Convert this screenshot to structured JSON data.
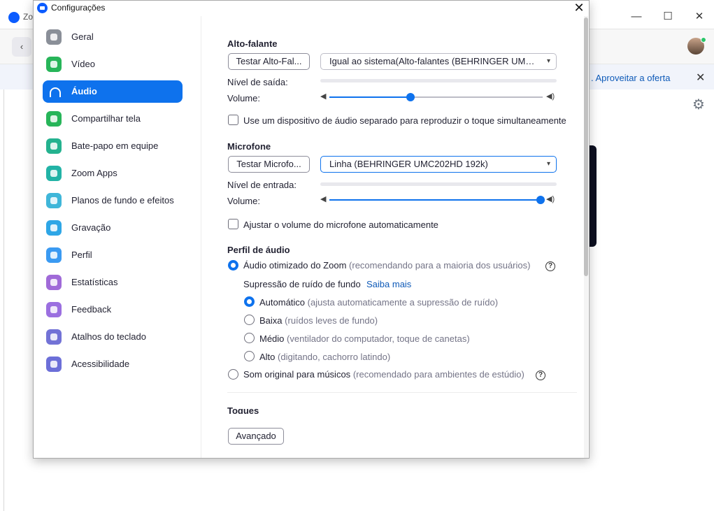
{
  "background": {
    "app_title": "Zoo",
    "offer_text": ". Aproveitar a oferta",
    "window_controls": {
      "minimize": "—",
      "maximize": "☐",
      "close": "✕"
    }
  },
  "dialog": {
    "title": "Configurações",
    "close_glyph": "✕"
  },
  "sidebar": {
    "items": [
      {
        "label": "Geral",
        "icon": "gear-icon",
        "color": "#8a8f98"
      },
      {
        "label": "Vídeo",
        "icon": "video-icon",
        "color": "#27b559"
      },
      {
        "label": "Áudio",
        "icon": "headphones-icon",
        "color": "#0e72ed",
        "active": true
      },
      {
        "label": "Compartilhar tela",
        "icon": "share-screen-icon",
        "color": "#27b559"
      },
      {
        "label": "Bate-papo em equipe",
        "icon": "chat-icon",
        "color": "#24b28f"
      },
      {
        "label": "Zoom Apps",
        "icon": "apps-icon",
        "color": "#22b3a6"
      },
      {
        "label": "Planos de fundo e efeitos",
        "icon": "background-icon",
        "color": "#3fb6d9"
      },
      {
        "label": "Gravação",
        "icon": "record-icon",
        "color": "#2ea6e6"
      },
      {
        "label": "Perfil",
        "icon": "profile-icon",
        "color": "#3a9af2"
      },
      {
        "label": "Estatísticas",
        "icon": "stats-icon",
        "color": "#a06ad8"
      },
      {
        "label": "Feedback",
        "icon": "feedback-icon",
        "color": "#9b6fe0"
      },
      {
        "label": "Atalhos do teclado",
        "icon": "keyboard-icon",
        "color": "#7272d6"
      },
      {
        "label": "Acessibilidade",
        "icon": "accessibility-icon",
        "color": "#6c6fd8"
      }
    ]
  },
  "speaker": {
    "title": "Alto-falante",
    "test_button": "Testar Alto-Fal...",
    "device": "Igual ao sistema(Alto-falantes (BEHRINGER UMC...",
    "output_level_label": "Nível de saída:",
    "volume_label": "Volume:",
    "volume": 0.38,
    "separate_device_label": "Use um dispositivo de áudio separado para reproduzir o toque simultaneamente",
    "separate_device_checked": false
  },
  "microphone": {
    "title": "Microfone",
    "test_button": "Testar Microfo...",
    "device": "Linha (BEHRINGER UMC202HD 192k)",
    "input_level_label": "Nível de entrada:",
    "volume_label": "Volume:",
    "volume": 0.99,
    "auto_adjust_label": "Ajustar o volume do microfone automaticamente",
    "auto_adjust_checked": false
  },
  "audio_profile": {
    "title": "Perfil de áudio",
    "optimized_label": "Áudio otimizado do Zoom",
    "optimized_hint": "(recomendando para a maioria dos usuários)",
    "noise_label": "Supressão de ruído de fundo",
    "learn_more": "Saiba mais",
    "options": [
      {
        "label": "Automático",
        "hint": "(ajusta automaticamente a supressão de ruído)",
        "selected": true
      },
      {
        "label": "Baixa",
        "hint": "(ruídos leves de fundo)",
        "selected": false
      },
      {
        "label": "Médio",
        "hint": "(ventilador do computador, toque de canetas)",
        "selected": false
      },
      {
        "label": "Alto",
        "hint": "(digitando, cachorro latindo)",
        "selected": false
      }
    ],
    "original_label": "Som original para músicos",
    "original_hint": "(recomendado para ambientes de estúdio)",
    "help_glyph": "?"
  },
  "ringtones": {
    "title": "Toques"
  },
  "advanced_button": "Avançado"
}
